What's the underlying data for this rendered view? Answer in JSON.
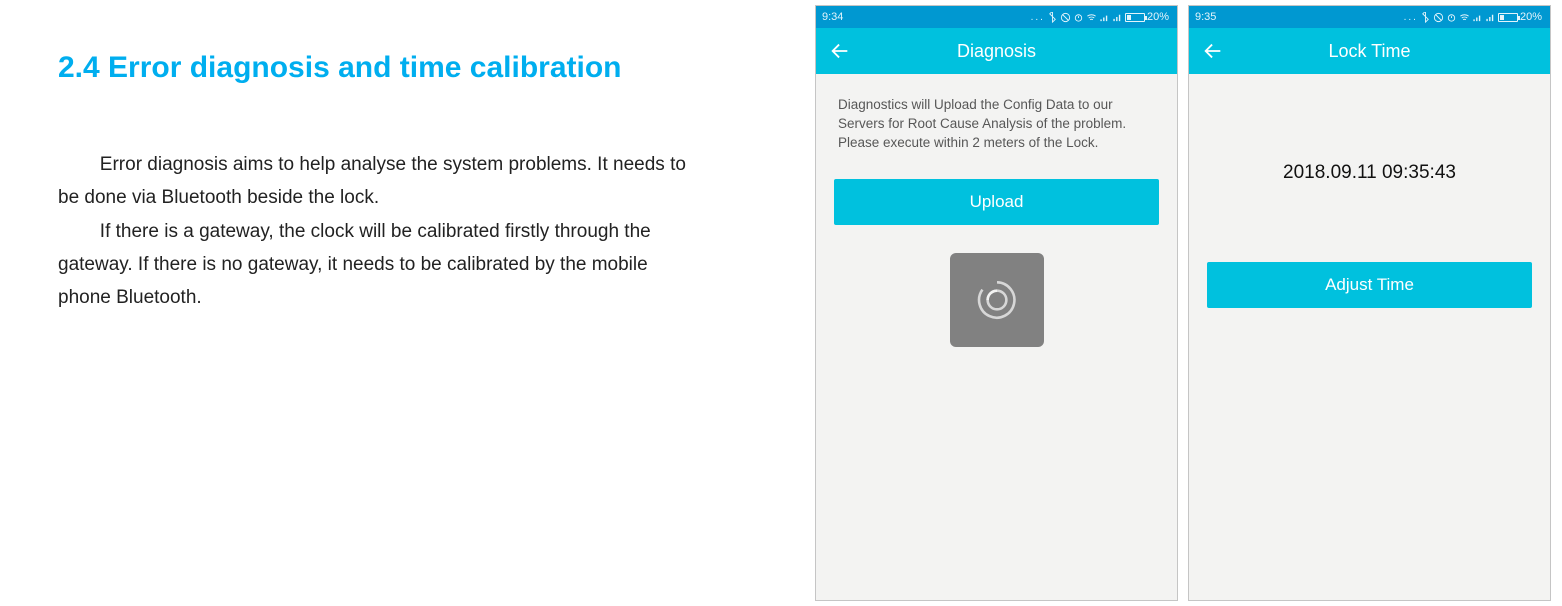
{
  "doc": {
    "title": "2.4 Error diagnosis and time calibration",
    "p1": "Error diagnosis aims to help analyse the system problems. It needs to be done via Bluetooth beside the lock.",
    "p2": "If there is a gateway, the clock will be calibrated firstly through the gateway. If there is no gateway, it needs to be calibrated by the mobile phone Bluetooth."
  },
  "status": {
    "time_left": "9:34",
    "time_right": "9:35",
    "battery_pct": "20%"
  },
  "screen1": {
    "title": "Diagnosis",
    "desc": "Diagnostics will Upload the Config Data to our Servers for Root Cause Analysis of the problem. Please execute within 2 meters of the Lock.",
    "button": "Upload"
  },
  "screen2": {
    "title": "Lock Time",
    "time": "2018.09.11 09:35:43",
    "button": "Adjust Time"
  }
}
